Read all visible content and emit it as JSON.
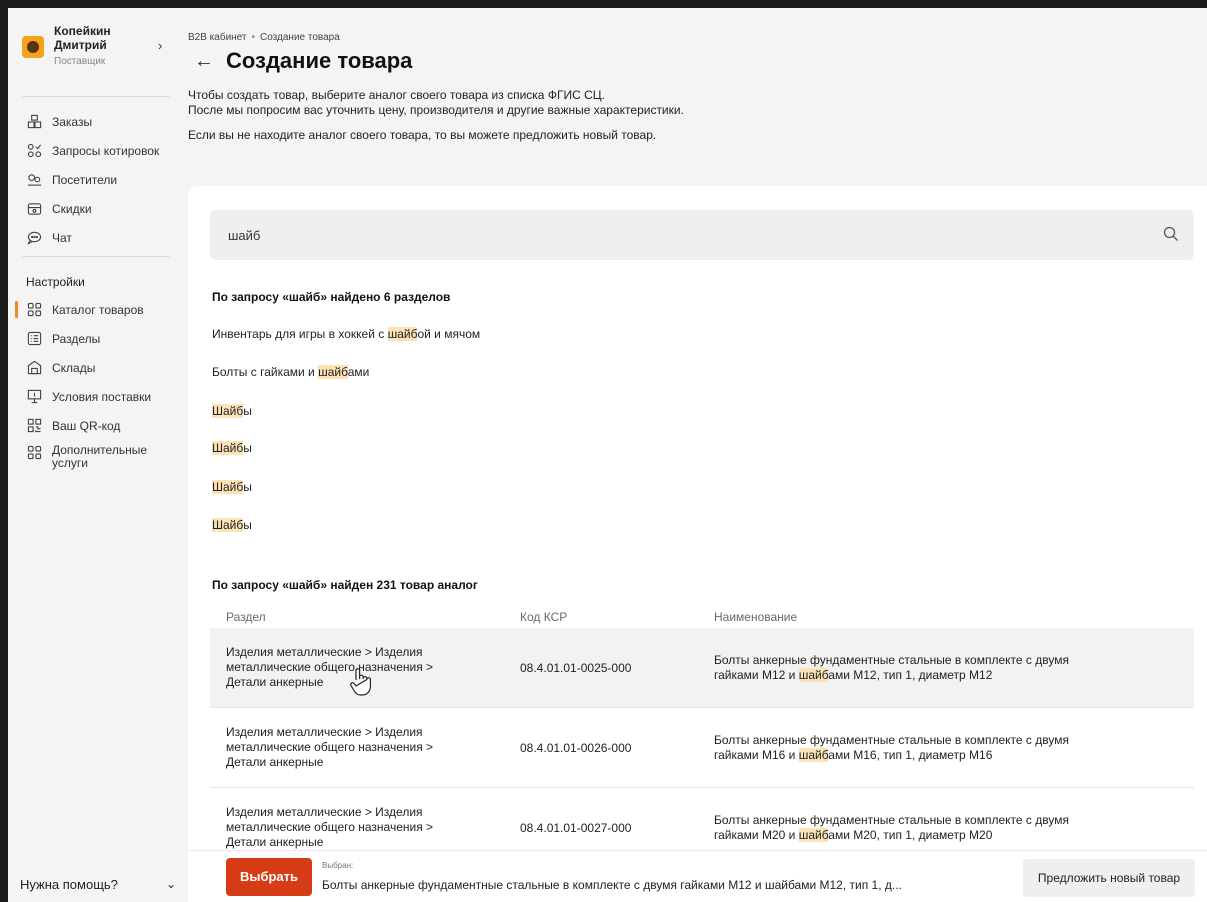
{
  "user": {
    "name_line1": "Копейкин",
    "name_line2": "Дмитрий",
    "role": "Поставщик",
    "avatar_icon": "bear-avatar"
  },
  "nav": {
    "items": [
      {
        "label": "Заказы",
        "icon": "orders-icon"
      },
      {
        "label": "Запросы котировок",
        "icon": "quotes-icon"
      },
      {
        "label": "Посетители",
        "icon": "visitors-icon"
      },
      {
        "label": "Скидки",
        "icon": "discounts-icon"
      },
      {
        "label": "Чат",
        "icon": "chat-icon"
      }
    ],
    "settings_heading": "Настройки",
    "settings_items": [
      {
        "label": "Каталог товаров",
        "icon": "catalog-icon",
        "active": true
      },
      {
        "label": "Разделы",
        "icon": "sections-icon"
      },
      {
        "label": "Склады",
        "icon": "warehouse-icon"
      },
      {
        "label": "Условия поставки",
        "icon": "delivery-icon"
      },
      {
        "label": "Ваш QR-код",
        "icon": "qr-icon"
      },
      {
        "label_line1": "Дополнительные",
        "label_line2": "услуги",
        "icon": "services-icon"
      }
    ],
    "help": "Нужна помощь?"
  },
  "breadcrumb": {
    "root": "B2B кабинет",
    "sep": "•",
    "current": "Создание товара"
  },
  "page_title": "Создание товара",
  "intro": {
    "line1": "Чтобы создать товар, выберите аналог своего товара из списка ФГИС СЦ.",
    "line2": "После мы попросим вас уточнить цену, производителя и другие важные характеристики.",
    "line3": "Если вы не находите аналог своего товара, то вы можете предложить новый товар."
  },
  "search": {
    "value": "шайб"
  },
  "sections": {
    "title": "По запросу «шайб» найдено 6 разделов",
    "items": [
      {
        "pre": "Инвентарь для игры в хоккей с ",
        "hl": "шайб",
        "post": "ой и мячом"
      },
      {
        "pre": "Болты с гайками и ",
        "hl": "шайб",
        "post": "ами"
      },
      {
        "pre": "",
        "hl": "Шайб",
        "post": "ы"
      },
      {
        "pre": "",
        "hl": "Шайб",
        "post": "ы"
      },
      {
        "pre": "",
        "hl": "Шайб",
        "post": "ы"
      },
      {
        "pre": "",
        "hl": "Шайб",
        "post": "ы"
      }
    ]
  },
  "products": {
    "title": "По запросу «шайб» найден 231 товар аналог",
    "headers": {
      "section": "Раздел",
      "code": "Код КСР",
      "name": "Наименование"
    },
    "rows": [
      {
        "section_l1": "Изделия металлические > Изделия",
        "section_l2": "металлические общего назначения >",
        "section_l3": "Детали анкерные",
        "code": "08.4.01.01-0025-000",
        "name_l1": "Болты анкерные фундаментные стальные в комплекте с двумя",
        "name_pre": "гайками М12 и ",
        "name_hl": "шайб",
        "name_post": "ами М12, тип 1, диаметр М12",
        "selected": true
      },
      {
        "section_l1": "Изделия металлические > Изделия",
        "section_l2": "металлические общего назначения >",
        "section_l3": "Детали анкерные",
        "code": "08.4.01.01-0026-000",
        "name_l1": "Болты анкерные фундаментные стальные в комплекте с двумя",
        "name_pre": "гайками М16 и ",
        "name_hl": "шайб",
        "name_post": "ами М16, тип 1, диаметр М16"
      },
      {
        "section_l1": "Изделия металлические > Изделия",
        "section_l2": "металлические общего назначения >",
        "section_l3": "Детали анкерные",
        "code": "08.4.01.01-0027-000",
        "name_l1": "Болты анкерные фундаментные стальные в комплекте с двумя",
        "name_pre": "гайками М20 и ",
        "name_hl": "шайб",
        "name_post": "ами М20, тип 1, диаметр М20"
      }
    ]
  },
  "footer": {
    "select_label": "Выбрать",
    "chosen_label": "Выбран:",
    "chosen_value": "Болты анкерные фундаментные стальные в комплекте с двумя гайками М12 и шайбами М12, тип 1, д...",
    "propose_label": "Предложить новый товар"
  },
  "colors": {
    "accent": "#f08a24",
    "primary_button": "#d63d17",
    "highlight": "#fbe3b6"
  }
}
